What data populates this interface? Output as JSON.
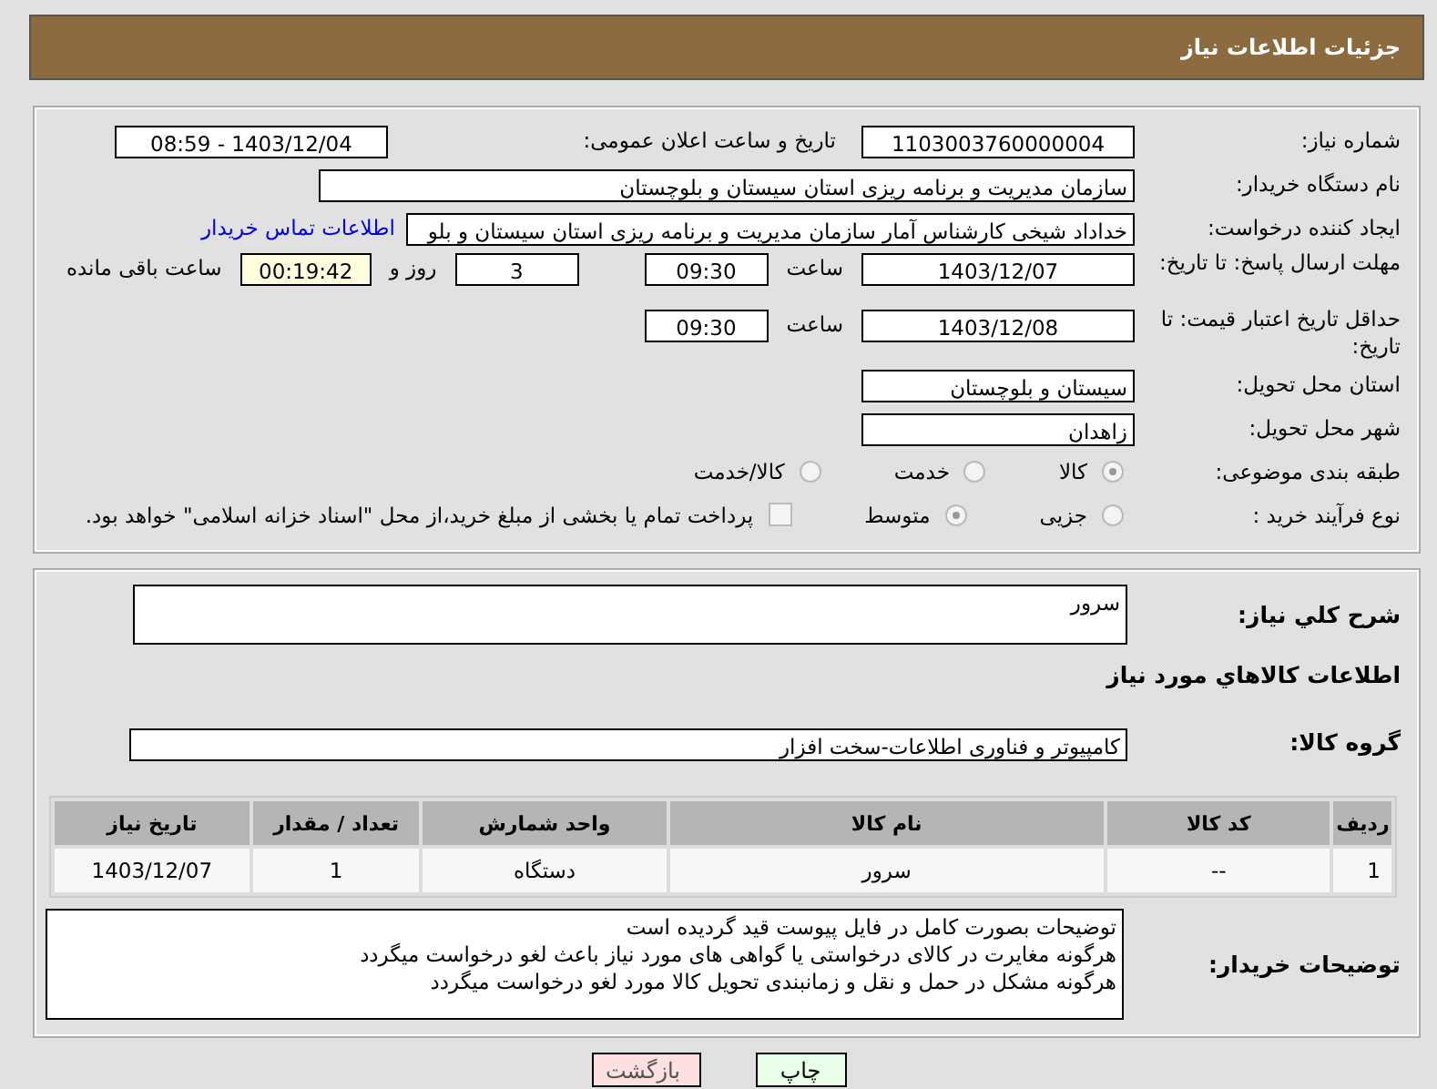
{
  "header": {
    "title": "جزئیات اطلاعات نیاز"
  },
  "need_number": {
    "label": "شماره نیاز:",
    "value": "1103003760000004"
  },
  "announce": {
    "label": "تاریخ و ساعت اعلان عمومی:",
    "value": "1403/12/04 - 08:59"
  },
  "buyer_org": {
    "label": "نام دستگاه خریدار:",
    "value": "سازمان مدیریت و برنامه ریزی استان سیستان و بلوچستان"
  },
  "requester": {
    "label": "ایجاد کننده درخواست:",
    "value": "خداداد شیخی کارشناس آمار سازمان مدیریت و برنامه ریزی استان سیستان و بلو",
    "link": "اطلاعات تماس خریدار"
  },
  "reply_deadline": {
    "label": "مهلت ارسال پاسخ: تا تاریخ:",
    "date": "1403/12/07",
    "time_label": "ساعت",
    "time": "09:30",
    "days": "3",
    "days_label": "روز و",
    "remaining": "00:19:42",
    "remaining_label": "ساعت باقی مانده"
  },
  "price_validity": {
    "label": "حداقل تاریخ اعتبار قیمت: تا تاریخ:",
    "date": "1403/12/08",
    "time_label": "ساعت",
    "time": "09:30"
  },
  "province": {
    "label": "استان محل تحویل:",
    "value": "سیستان و بلوچستان"
  },
  "city": {
    "label": "شهر محل تحویل:",
    "value": "زاهدان"
  },
  "category": {
    "label": "طبقه بندی موضوعی:",
    "options": [
      {
        "label": "کالا",
        "selected": true
      },
      {
        "label": "خدمت",
        "selected": false
      },
      {
        "label": "کالا/خدمت",
        "selected": false
      }
    ]
  },
  "process": {
    "label": "نوع فرآیند خرید :",
    "options": [
      {
        "label": "جزیی",
        "selected": false
      },
      {
        "label": "متوسط",
        "selected": true
      }
    ],
    "payment": {
      "checked": false,
      "text": "پرداخت تمام یا بخشی از مبلغ خرید،از محل \"اسناد خزانه اسلامی\" خواهد بود."
    }
  },
  "description": {
    "label": "شرح كلي نياز:",
    "value": "سرور"
  },
  "goods_heading": "اطلاعات كالاهاي مورد نياز",
  "goods_group": {
    "label": "گروه کالا:",
    "value": "کامپیوتر و فناوری اطلاعات-سخت افزار"
  },
  "table": {
    "columns": [
      "ردیف",
      "کد کالا",
      "نام کالا",
      "واحد شمارش",
      "تعداد / مقدار",
      "تاریخ نیاز"
    ],
    "rows": [
      [
        "1",
        "--",
        "سرور",
        "دستگاه",
        "1",
        "1403/12/07"
      ]
    ]
  },
  "buyer_notes": {
    "label": "توضیحات خریدار:",
    "lines": [
      "توضیحات بصورت کامل در فایل پیوست قید گردیده است",
      "هرگونه مغایرت در کالای درخواستی یا گواهی های مورد نیاز باعث لغو درخواست میگردد",
      "هرگونه مشکل در حمل و نقل و زمانبندی تحویل کالا مورد لغو درخواست میگردد"
    ]
  },
  "buttons": [
    {
      "label": "چاپ",
      "kind": "print"
    },
    {
      "label": "بازگشت",
      "kind": "back"
    }
  ]
}
